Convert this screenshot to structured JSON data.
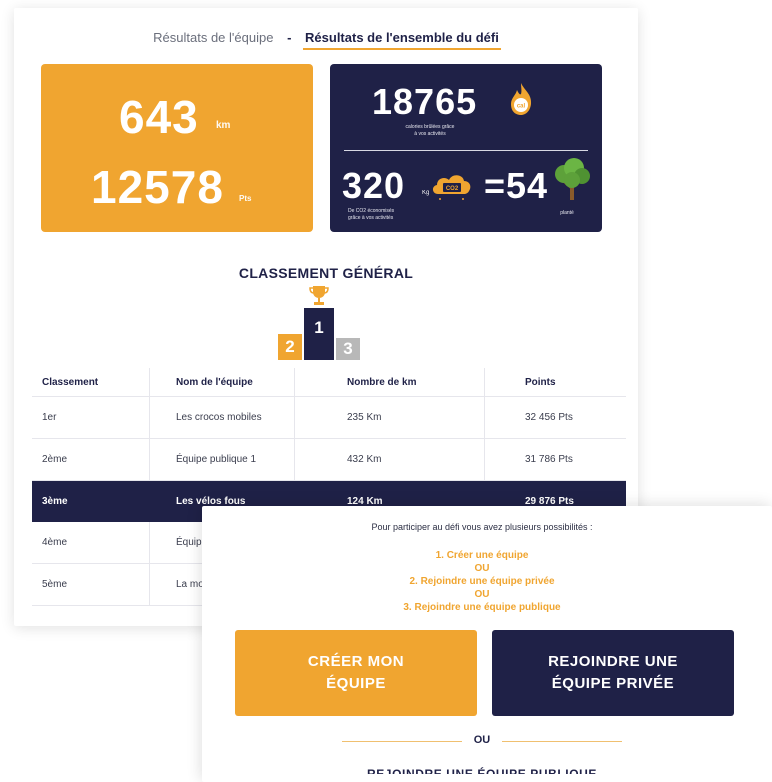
{
  "tabs": {
    "team_results": "Résultats de l'équipe",
    "separator": "-",
    "overall_results": "Résultats de l'ensemble du défi"
  },
  "stats": {
    "distance_value": "643",
    "distance_unit": "km",
    "points_value": "12578",
    "points_unit": "Pts",
    "calories_value": "18765",
    "calories_badge": "cal",
    "calories_caption_1": "calories brûlées grâce",
    "calories_caption_2": "à vos activités",
    "co2_value": "320",
    "co2_unit": "Kg",
    "co2_badge": "CO2",
    "co2_caption_1": "De CO2 économisés",
    "co2_caption_2": "grâce à vos activités",
    "trees_value": "=54",
    "trees_caption": "planté"
  },
  "ranking": {
    "title": "CLASSEMENT GÉNÉRAL",
    "podium": [
      "2",
      "1",
      "3"
    ],
    "headers": [
      "Classement",
      "Nom de l'équipe",
      "Nombre de km",
      "Points"
    ],
    "rows": [
      {
        "rank": "1er",
        "team": "Les crocos mobiles",
        "km": "235 Km",
        "points": "32 456 Pts"
      },
      {
        "rank": "2ème",
        "team": "Équipe publique 1",
        "km": "432 Km",
        "points": "31 786 Pts"
      },
      {
        "rank": "3ème",
        "team": "Les vélos fous",
        "km": "124 Km",
        "points": "29 876 Pts"
      },
      {
        "rank": "4ème",
        "team": "Équip",
        "km": "",
        "points": ""
      },
      {
        "rank": "5ème",
        "team": "La mo",
        "km": "",
        "points": ""
      }
    ]
  },
  "join": {
    "intro": "Pour participer au défi vous avez plusieurs possibilités :",
    "option_1": "1. Créer une équipe",
    "or_1": "OU",
    "option_2": "2. Rejoindre une équipe privée",
    "or_2": "OU",
    "option_3": "3. Rejoindre une équipe publique",
    "create_line_1": "CRÉER MON",
    "create_line_2": "ÉQUIPE",
    "join_private_line_1": "REJOINDRE UNE",
    "join_private_line_2": "ÉQUIPE PRIVÉE",
    "or_divider": "OU",
    "join_public_cut": "REJOINDRE UNE ÉQUIPE PUBLIQUE"
  },
  "colors": {
    "orange": "#f0a530",
    "navy": "#1f2147",
    "grey_podium": "#b8b8b8"
  }
}
